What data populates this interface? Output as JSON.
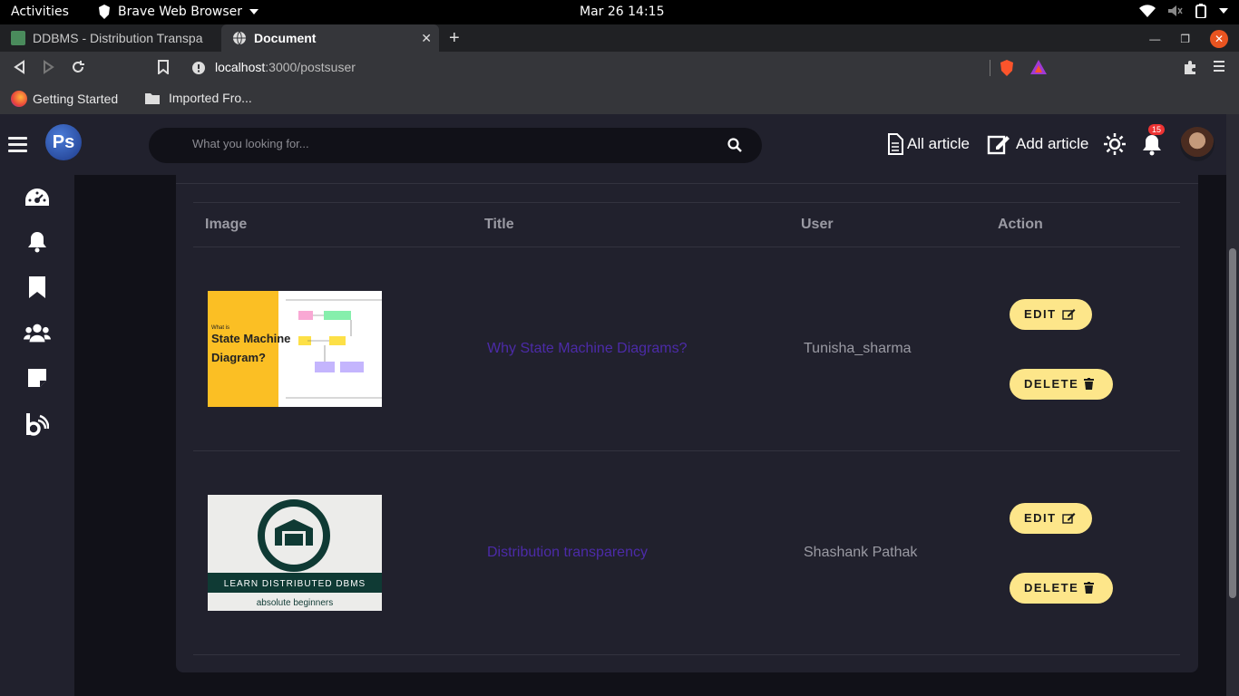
{
  "os": {
    "activities": "Activities",
    "app_name": "Brave Web Browser",
    "clock": "Mar 26  14:15"
  },
  "browser": {
    "tabs": [
      {
        "label": "DDBMS - Distribution Transpa"
      },
      {
        "label": "Document"
      }
    ],
    "url": {
      "host": "localhost",
      "path": ":3000/postsuser"
    },
    "bookmarks": [
      {
        "label": "Getting Started"
      },
      {
        "label": "Imported Fro..."
      }
    ]
  },
  "navbar": {
    "logo": "Ps",
    "search_placeholder": "What you looking for...",
    "all_article": "All article",
    "add_article": "Add article",
    "notification_count": "15"
  },
  "table": {
    "headers": {
      "image": "Image",
      "title": "Title",
      "user": "User",
      "action": "Action"
    },
    "rows": [
      {
        "title": "Why State Machine Diagrams?",
        "user": "Tunisha_sharma",
        "edit": "EDIT",
        "delete": "DELETE",
        "thumb_text": [
          "What is",
          "State Machine",
          "Diagram?"
        ]
      },
      {
        "title": "Distribution transparency",
        "user": "Shashank Pathak",
        "edit": "EDIT",
        "delete": "DELETE",
        "thumb_text": [
          "LEARN DISTRIBUTED DBMS",
          "absolute beginners"
        ]
      }
    ]
  },
  "icons": [
    "hamburger-icon",
    "search-icon",
    "document-icon",
    "edit-icon",
    "sun-icon",
    "bell-icon",
    "dashboard-icon",
    "notification-icon",
    "bookmark-icon",
    "users-icon",
    "note-icon",
    "blog-icon",
    "trash-icon"
  ]
}
